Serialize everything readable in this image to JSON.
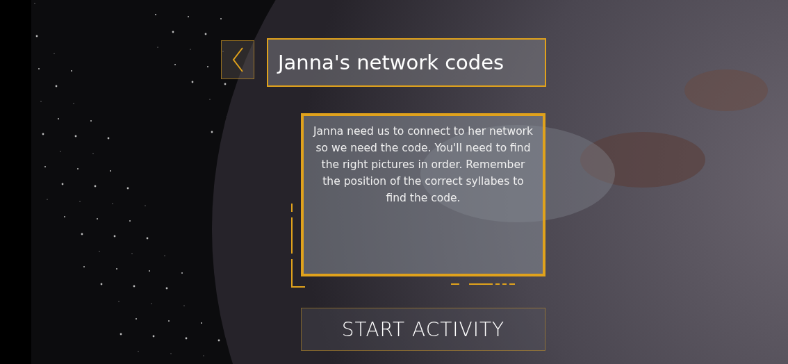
{
  "header": {
    "title": "Janna's network codes"
  },
  "description": "Janna need us to connect to her network so we need the code. You'll need to find the right pictures in order. Remember the position of the correct syllabes to find the code.",
  "start_button": {
    "label": "START ACTIVITY"
  }
}
